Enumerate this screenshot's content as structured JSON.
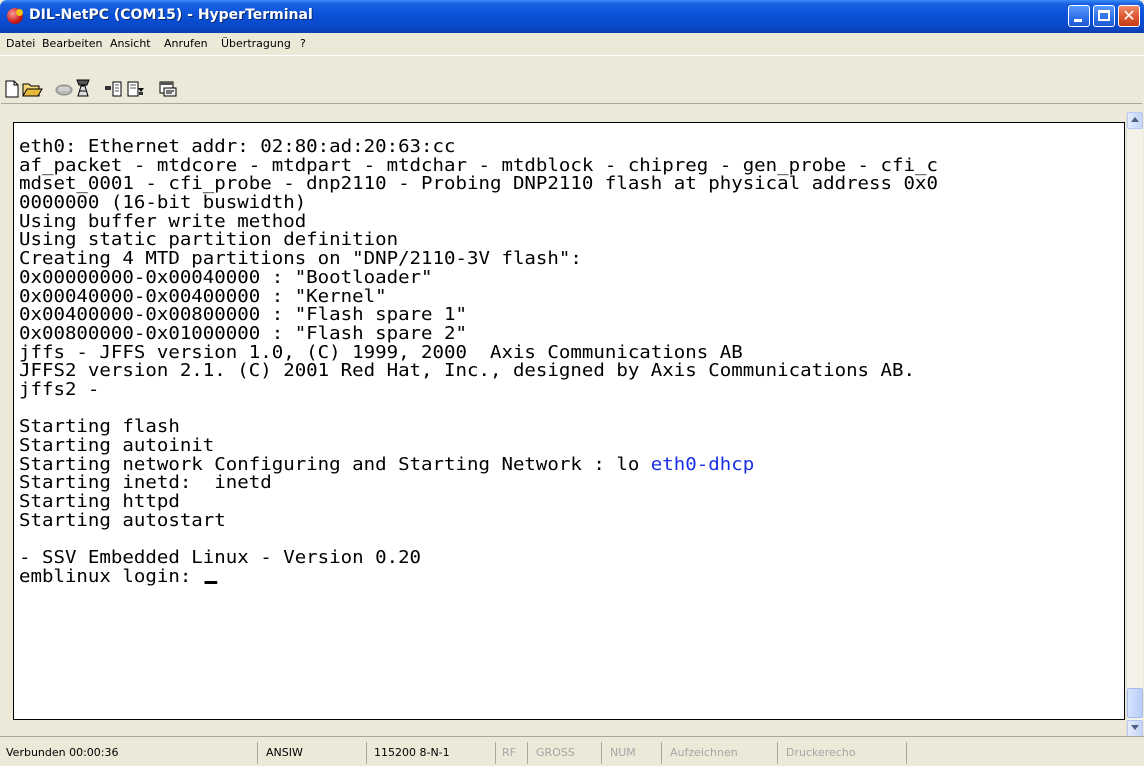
{
  "window": {
    "title": "DIL-NetPC (COM15) - HyperTerminal"
  },
  "menu": [
    "Datei",
    "Bearbeiten",
    "Ansicht",
    "Anrufen",
    "Übertragung",
    "?"
  ],
  "toolbar": {
    "icons": [
      "new-icon",
      "open-icon",
      "disconnect-icon",
      "phone-icon",
      "send-icon",
      "receive-icon",
      "properties-icon"
    ]
  },
  "terminal": {
    "lines": [
      "eth0: Ethernet addr: 02:80:ad:20:63:cc",
      "af_packet - mtdcore - mtdpart - mtdchar - mtdblock - chipreg - gen_probe - cfi_c",
      "mdset_0001 - cfi_probe - dnp2110 - Probing DNP2110 flash at physical address 0x0",
      "0000000 (16-bit buswidth)",
      "Using buffer write method",
      "Using static partition definition",
      "Creating 4 MTD partitions on \"DNP/2110-3V flash\":",
      "0x00000000-0x00040000 : \"Bootloader\"",
      "0x00040000-0x00400000 : \"Kernel\"",
      "0x00400000-0x00800000 : \"Flash spare 1\"",
      "0x00800000-0x01000000 : \"Flash spare 2\"",
      "jffs - JFFS version 1.0, (C) 1999, 2000  Axis Communications AB",
      "JFFS2 version 2.1. (C) 2001 Red Hat, Inc., designed by Axis Communications AB.",
      "jffs2 -",
      "",
      "Starting flash",
      "Starting autoinit",
      "Starting network Configuring and Starting Network : lo ",
      "Starting inetd:  inetd",
      "Starting httpd",
      "Starting autostart",
      "",
      "- SSV Embedded Linux - Version 0.20",
      "emblinux login: "
    ],
    "highlight": "eth0-dhcp",
    "highlight_color": "#1a2ee6"
  },
  "status": {
    "connected": "Verbunden 00:00:36",
    "emulation": "ANSIW",
    "port_settings": "115200 8-N-1",
    "rf": "RF",
    "gross": "GROSS",
    "num": "NUM",
    "capture": "Aufzeichnen",
    "print_echo": "Druckerecho"
  }
}
